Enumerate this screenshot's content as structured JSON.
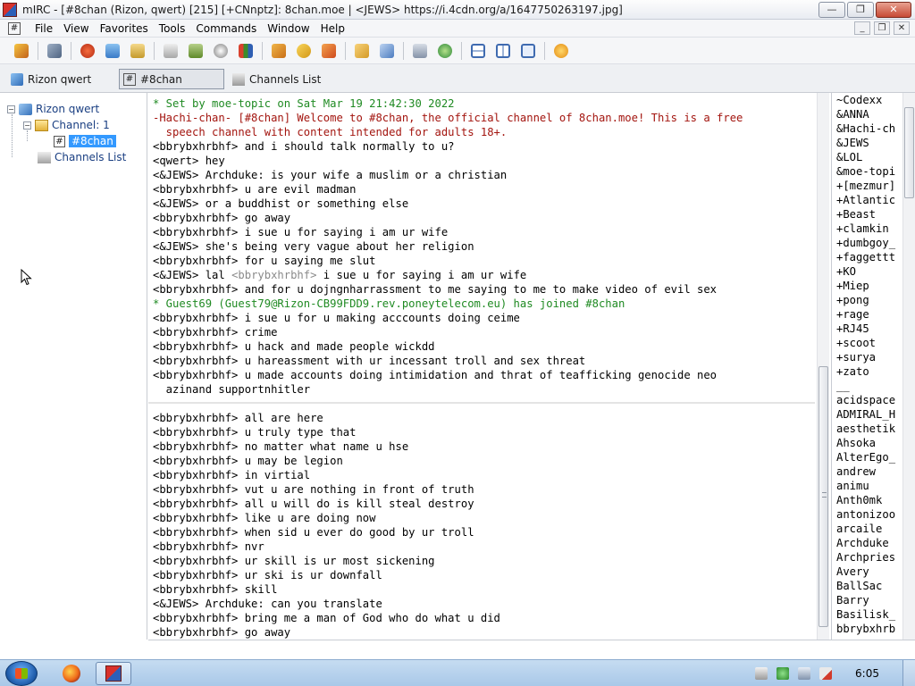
{
  "window": {
    "title": "mIRC - [#8chan (Rizon, qwert) [215] [+CNnptz]: 8chan.moe | <JEWS> https://i.4cdn.org/a/1647750263197.jpg]",
    "minimize": "—",
    "maximize": "❐",
    "close": "✕"
  },
  "menubar": {
    "items": [
      "File",
      "View",
      "Favorites",
      "Tools",
      "Commands",
      "Window",
      "Help"
    ],
    "mdi_minimize": "_",
    "mdi_restore": "❐",
    "mdi_close": "✕"
  },
  "switchbar": {
    "items": [
      {
        "label": "Rizon qwert"
      },
      {
        "label": "#8chan"
      },
      {
        "label": "Channels List"
      }
    ]
  },
  "tree": {
    "toggle_open": "−",
    "network": "Rizon qwert",
    "channel_folder": "Channel: 1",
    "channel": "#8chan",
    "channels_list": "Channels List"
  },
  "chat": {
    "lines": [
      {
        "text": "* Set by moe-topic on Sat Mar 19 21:42:30 2022",
        "color": "green"
      },
      {
        "text": "-Hachi-chan- [#8chan] Welcome to #8chan, the official channel of 8chan.moe! This is a free\n  speech channel with content intended for adults 18+.",
        "color": "red",
        "wrap": true
      },
      {
        "text": "<bbrybxhrbhf> and i should talk normally to u?"
      },
      {
        "text": "<qwert> hey"
      },
      {
        "text": "<&JEWS> Archduke: is your wife a muslim or a christian"
      },
      {
        "text": "<bbrybxhrbhf> u are evil madman"
      },
      {
        "text": "<&JEWS> or a buddhist or something else"
      },
      {
        "text": "<bbrybxhrbhf> go away"
      },
      {
        "text": "<bbrybxhrbhf> i sue u for saying i am ur wife"
      },
      {
        "text": "<&JEWS> she's being very vague about her religion"
      },
      {
        "text": "<bbrybxhrbhf> for u saying me slut"
      },
      {
        "prefix": "<&JEWS> lal ",
        "quoted": "<bbrybxhrbhf>",
        "suffix": " i sue u for saying i am ur wife"
      },
      {
        "text": "<bbrybxhrbhf> and for u dojngnharrassment to me saying to me to make video of evil sex"
      },
      {
        "text": "* Guest69 (Guest79@Rizon-CB99FDD9.rev.poneytelecom.eu) has joined #8chan",
        "color": "green"
      },
      {
        "text": "<bbrybxhrbhf> i sue u for u making acccounts doing ceime"
      },
      {
        "text": "<bbrybxhrbhf> crime"
      },
      {
        "text": "<bbrybxhrbhf> u hack and made people wickdd"
      },
      {
        "text": "<bbrybxhrbhf> u hareassment with ur incessant troll and sex threat"
      },
      {
        "text": "<bbrybxhrbhf> u made accounts doing intimidation and thrat of teafficking genocide neo\n  azinand supportnhitler",
        "wrap": true
      },
      {
        "text": "",
        "blank": true
      },
      {
        "text": "<bbrybxhrbhf> all are here"
      },
      {
        "text": "<bbrybxhrbhf> u truly type that"
      },
      {
        "text": "<bbrybxhrbhf> no matter what name u hse"
      },
      {
        "text": "<bbrybxhrbhf> u may be legion"
      },
      {
        "text": "<bbrybxhrbhf> in virtial"
      },
      {
        "text": "<bbrybxhrbhf> vut u are nothing in front of truth"
      },
      {
        "text": "<bbrybxhrbhf> all u will do is kill steal destroy"
      },
      {
        "text": "<bbrybxhrbhf> like u are doing now"
      },
      {
        "text": "<bbrybxhrbhf> when sid u ever do good by ur troll"
      },
      {
        "text": "<bbrybxhrbhf> nvr"
      },
      {
        "text": "<bbrybxhrbhf> ur skill is ur most sickening"
      },
      {
        "text": "<bbrybxhrbhf> ur ski is ur downfall"
      },
      {
        "text": "<bbrybxhrbhf> skill"
      },
      {
        "text": "<&JEWS> Archduke: can you translate"
      },
      {
        "text": "<bbrybxhrbhf> bring me a man of God who do what u did"
      },
      {
        "text": "<bbrybxhrbhf> go away"
      }
    ],
    "input_value": ""
  },
  "nicklist": {
    "nicks": [
      "~Codexx",
      "&ANNA",
      "&Hachi-ch",
      "&JEWS",
      "&LOL",
      "&moe-topi",
      "+[mezmur]",
      "+Atlantic",
      "+Beast",
      "+clamkin",
      "+dumbgoy_",
      "+faggettt",
      "+KO",
      "+Miep",
      "+pong",
      "+rage",
      "+RJ45",
      "+scoot",
      "+surya",
      "+zato",
      "__",
      "acidspace",
      "ADMIRAL_H",
      "aesthetik",
      "Ahsoka",
      "AlterEgo_",
      "andrew",
      "animu",
      "Anth0mk",
      "antonizoo",
      "arcaile",
      "Archduke",
      "Archpries",
      "Avery",
      "BallSac",
      "Barry",
      "Basilisk_",
      "bbrybxhrb"
    ]
  },
  "taskbar": {
    "clock": "6:05"
  },
  "colors": {
    "action_green": "#1f8a22",
    "notice_red": "#a3150f",
    "quoted_grey": "#8a8a8a",
    "selection_blue": "#3399ff"
  }
}
